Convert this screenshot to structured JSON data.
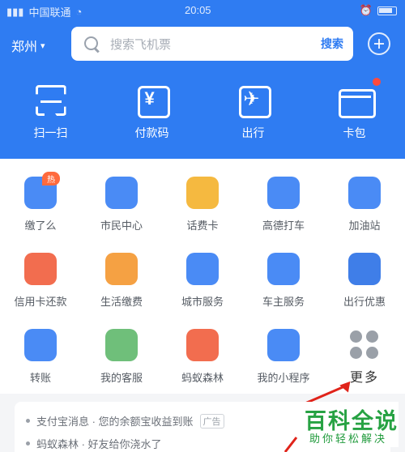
{
  "status_bar": {
    "carrier": "中国联通",
    "time": "20:05"
  },
  "header": {
    "city": "郑州",
    "search_placeholder": "搜索飞机票",
    "search_button": "搜索"
  },
  "top_nav": [
    {
      "label": "扫一扫",
      "icon": "scan-icon"
    },
    {
      "label": "付款码",
      "icon": "payment-code-icon"
    },
    {
      "label": "出行",
      "icon": "travel-icon"
    },
    {
      "label": "卡包",
      "icon": "card-wallet-icon"
    }
  ],
  "grid": [
    {
      "label": "缴了么",
      "icon": "bill-clock-icon",
      "color": "#4a8bf5",
      "badge": "热"
    },
    {
      "label": "市民中心",
      "icon": "citizen-center-icon",
      "color": "#4a8bf5"
    },
    {
      "label": "话费卡",
      "icon": "coin-icon",
      "color": "#f5b940"
    },
    {
      "label": "高德打车",
      "icon": "diamond-icon",
      "color": "#4a8bf5"
    },
    {
      "label": "加油站",
      "icon": "car-icon",
      "color": "#4a8bf5"
    },
    {
      "label": "信用卡还款",
      "icon": "credit-card-icon",
      "color": "#f26d4f"
    },
    {
      "label": "生活缴费",
      "icon": "receipt-icon",
      "color": "#f5a143"
    },
    {
      "label": "城市服务",
      "icon": "city-service-icon",
      "color": "#4a8bf5"
    },
    {
      "label": "车主服务",
      "icon": "vehicle-service-icon",
      "color": "#4a8bf5"
    },
    {
      "label": "出行优惠",
      "icon": "discount-icon",
      "color": "#3f7ee8"
    },
    {
      "label": "转账",
      "icon": "transfer-icon",
      "color": "#4a8bf5"
    },
    {
      "label": "我的客服",
      "icon": "service-icon",
      "color": "#6fbf7a"
    },
    {
      "label": "蚂蚁森林",
      "icon": "forest-icon",
      "color": "#f26d4f"
    },
    {
      "label": "我的小程序",
      "icon": "mini-program-icon",
      "color": "#4a8bf5"
    },
    {
      "label": "更多",
      "icon": "more-grid-icon",
      "color": "#9aa0a8"
    }
  ],
  "news": [
    {
      "text": "支付宝消息 · 您的余额宝收益到账",
      "tag": "广告"
    },
    {
      "text": "蚂蚁森林 · 好友给你浇水了",
      "tag": ""
    }
  ],
  "watermark": {
    "title": "百科全说",
    "subtitle": "助你轻松解决"
  },
  "colors": {
    "brand_blue": "#2f7cf2",
    "arrow_red": "#e0231a",
    "watermark_green": "#27a243"
  }
}
